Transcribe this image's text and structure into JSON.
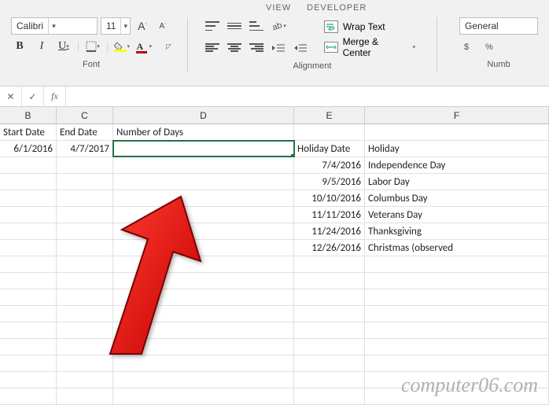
{
  "ribbon": {
    "tabs": {
      "view": "VIEW",
      "developer": "DEVELOPER"
    },
    "font": {
      "name": "Calibri",
      "size": "11",
      "increase": "A",
      "decrease": "A",
      "bold": "B",
      "italic": "I",
      "underline": "U",
      "font_color_letter": "A",
      "group_label": "Font"
    },
    "alignment": {
      "wrap_label": "Wrap Text",
      "merge_label": "Merge & Center",
      "group_label": "Alignment"
    },
    "number": {
      "format": "General",
      "group_label": "Numb"
    }
  },
  "formula_bar": {
    "cancel": "✕",
    "enter": "✓",
    "fx": "fx",
    "value": ""
  },
  "columns": {
    "B": "B",
    "C": "C",
    "D": "D",
    "E": "E",
    "F": "F"
  },
  "headers": {
    "start_date": "Start Date",
    "end_date": "End Date",
    "num_days": "Number of Days",
    "holiday_date": "Holiday Date",
    "holiday": "Holiday"
  },
  "data": {
    "start_date": "6/1/2016",
    "end_date": "4/7/2017",
    "holidays": [
      {
        "date": "7/4/2016",
        "name": "Independence Day"
      },
      {
        "date": "9/5/2016",
        "name": "Labor Day"
      },
      {
        "date": "10/10/2016",
        "name": "Columbus Day"
      },
      {
        "date": "11/11/2016",
        "name": "Veterans Day"
      },
      {
        "date": "11/24/2016",
        "name": "Thanksgiving"
      },
      {
        "date": "12/26/2016",
        "name": "Christmas (observed"
      }
    ]
  },
  "watermark": "computer06.com",
  "chart_data": null
}
